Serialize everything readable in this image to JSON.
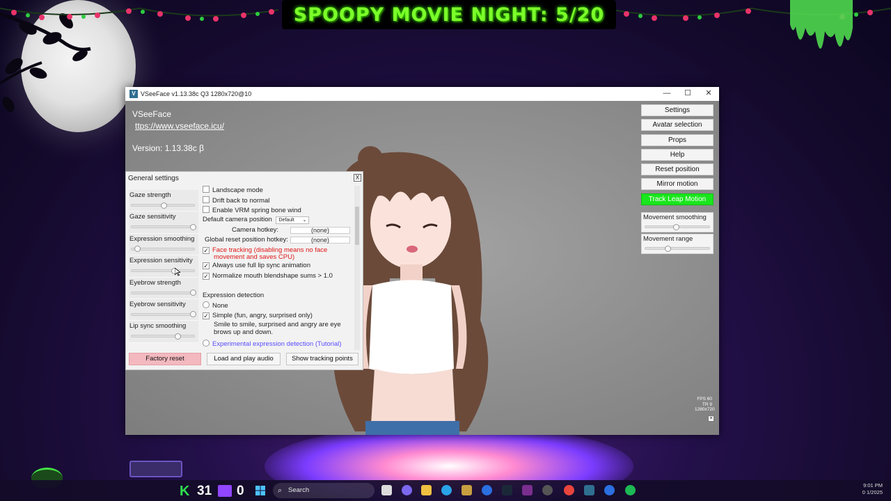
{
  "overlay": {
    "banner": "SPOOPY MOVIE NIGHT: 5/20"
  },
  "window": {
    "title": "VSeeFace v1.13.38c Q3 1280x720@10",
    "controls": {
      "minimize": "—",
      "maximize": "☐",
      "close": "✕"
    }
  },
  "app": {
    "name": "VSeeFace",
    "url": "ttps://www.vseeface.icu/",
    "version": "Version: 1.13.38c β"
  },
  "menu": {
    "buttons": [
      {
        "label": "Settings",
        "active": false
      },
      {
        "label": "Avatar selection",
        "active": false
      },
      {
        "label": "Props",
        "active": false
      },
      {
        "label": "Help",
        "active": false
      },
      {
        "label": "Reset position",
        "active": false
      },
      {
        "label": "Mirror motion",
        "active": false
      },
      {
        "label": "Track Leap Motion",
        "active": true
      }
    ],
    "sliders": [
      {
        "label": "Movement smoothing",
        "value": 0.48
      },
      {
        "label": "Movement range",
        "value": 0.36
      }
    ],
    "accent_color": "#19e61c"
  },
  "stats": {
    "fps": "FPS 60",
    "tr": "TR 9",
    "res": "1280x720"
  },
  "general_settings": {
    "title": "General settings",
    "close": "X",
    "sliders": [
      {
        "label": "Gaze strength",
        "value": 0.52
      },
      {
        "label": "Gaze sensitivity",
        "value": 0.97
      },
      {
        "label": "Expression smoothing",
        "value": 0.1
      },
      {
        "label": "Expression sensitivity",
        "value": 0.68
      },
      {
        "label": "Eyebrow strength",
        "value": 0.97
      },
      {
        "label": "Eyebrow sensitivity",
        "value": 0.97
      },
      {
        "label": "Lip sync smoothing",
        "value": 0.73
      }
    ],
    "options": {
      "landscape": "Landscape mode",
      "drift": "Drift back to normal",
      "spring": "Enable VRM spring bone wind",
      "camera_position_label": "Default camera position",
      "camera_position_value": "Default",
      "camera_hotkey_label": "Camera hotkey:",
      "camera_hotkey_value": "(none)",
      "reset_hotkey_label": "Global reset position hotkey:",
      "reset_hotkey_value": "(none)",
      "face_tracking_1": "Face tracking (disabling means no face",
      "face_tracking_2": "movement and saves CPU)",
      "full_lip_sync": "Always use full lip sync animation",
      "normalize": "Normalize mouth blendshape sums > 1.0",
      "expr_header": "Expression detection",
      "expr_none": "None",
      "expr_simple": "Simple (fun, angry, surprised only)",
      "expr_simple_desc_1": "Smile to smile, surprised and angry are eye",
      "expr_simple_desc_2": "brows up and down.",
      "expr_experimental": "Experimental expression detection (Tutorial)"
    },
    "checked": {
      "landscape": false,
      "drift": false,
      "spring": false,
      "face_tracking": true,
      "full_lip_sync": true,
      "normalize": true
    },
    "buttons": {
      "factory_reset": "Factory reset",
      "load_audio": "Load and play audio",
      "tracking_points": "Show tracking points"
    }
  },
  "taskbar": {
    "k_label": "K",
    "viewer_count": "31",
    "follower_count": "0",
    "search_placeholder": "Search",
    "time": "9:01 PM",
    "date": "0 1/2025"
  }
}
